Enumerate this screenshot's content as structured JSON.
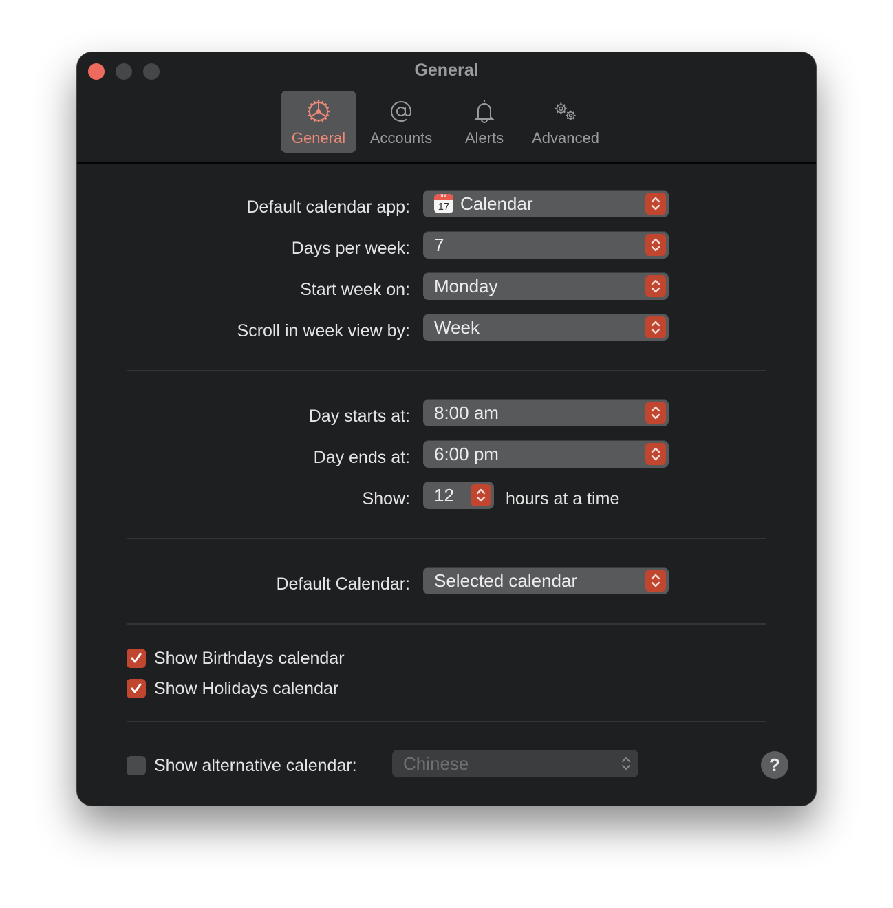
{
  "window": {
    "title": "General",
    "controls": [
      "close",
      "minimize",
      "zoom"
    ]
  },
  "tabs": [
    {
      "label": "General",
      "icon": "gear-icon",
      "active": true
    },
    {
      "label": "Accounts",
      "icon": "at-icon",
      "active": false
    },
    {
      "label": "Alerts",
      "icon": "bell-icon",
      "active": false
    },
    {
      "label": "Advanced",
      "icon": "gears-icon",
      "active": false
    }
  ],
  "settings": {
    "default_calendar_app": {
      "label": "Default calendar app:",
      "value": "Calendar",
      "icon_month": "JUL",
      "icon_day": "17"
    },
    "days_per_week": {
      "label": "Days per week:",
      "value": "7"
    },
    "start_week_on": {
      "label": "Start week on:",
      "value": "Monday"
    },
    "scroll_week_view": {
      "label": "Scroll in week view by:",
      "value": "Week"
    },
    "day_starts_at": {
      "label": "Day starts at:",
      "value": "8:00 am"
    },
    "day_ends_at": {
      "label": "Day ends at:",
      "value": "6:00 pm"
    },
    "show_hours": {
      "label": "Show:",
      "value": "12",
      "suffix": "hours at a time"
    },
    "default_calendar": {
      "label": "Default Calendar:",
      "value": "Selected calendar"
    },
    "show_birthdays": {
      "label": "Show Birthdays calendar",
      "checked": true
    },
    "show_holidays": {
      "label": "Show Holidays calendar",
      "checked": true
    },
    "show_alternative": {
      "label": "Show alternative calendar:",
      "checked": false,
      "value": "Chinese",
      "enabled": false
    }
  },
  "help": {
    "label": "?"
  },
  "colors": {
    "accent": "#c0462f",
    "accent_text": "#f08a78",
    "background": "#1e1f21",
    "control": "#58595b"
  }
}
